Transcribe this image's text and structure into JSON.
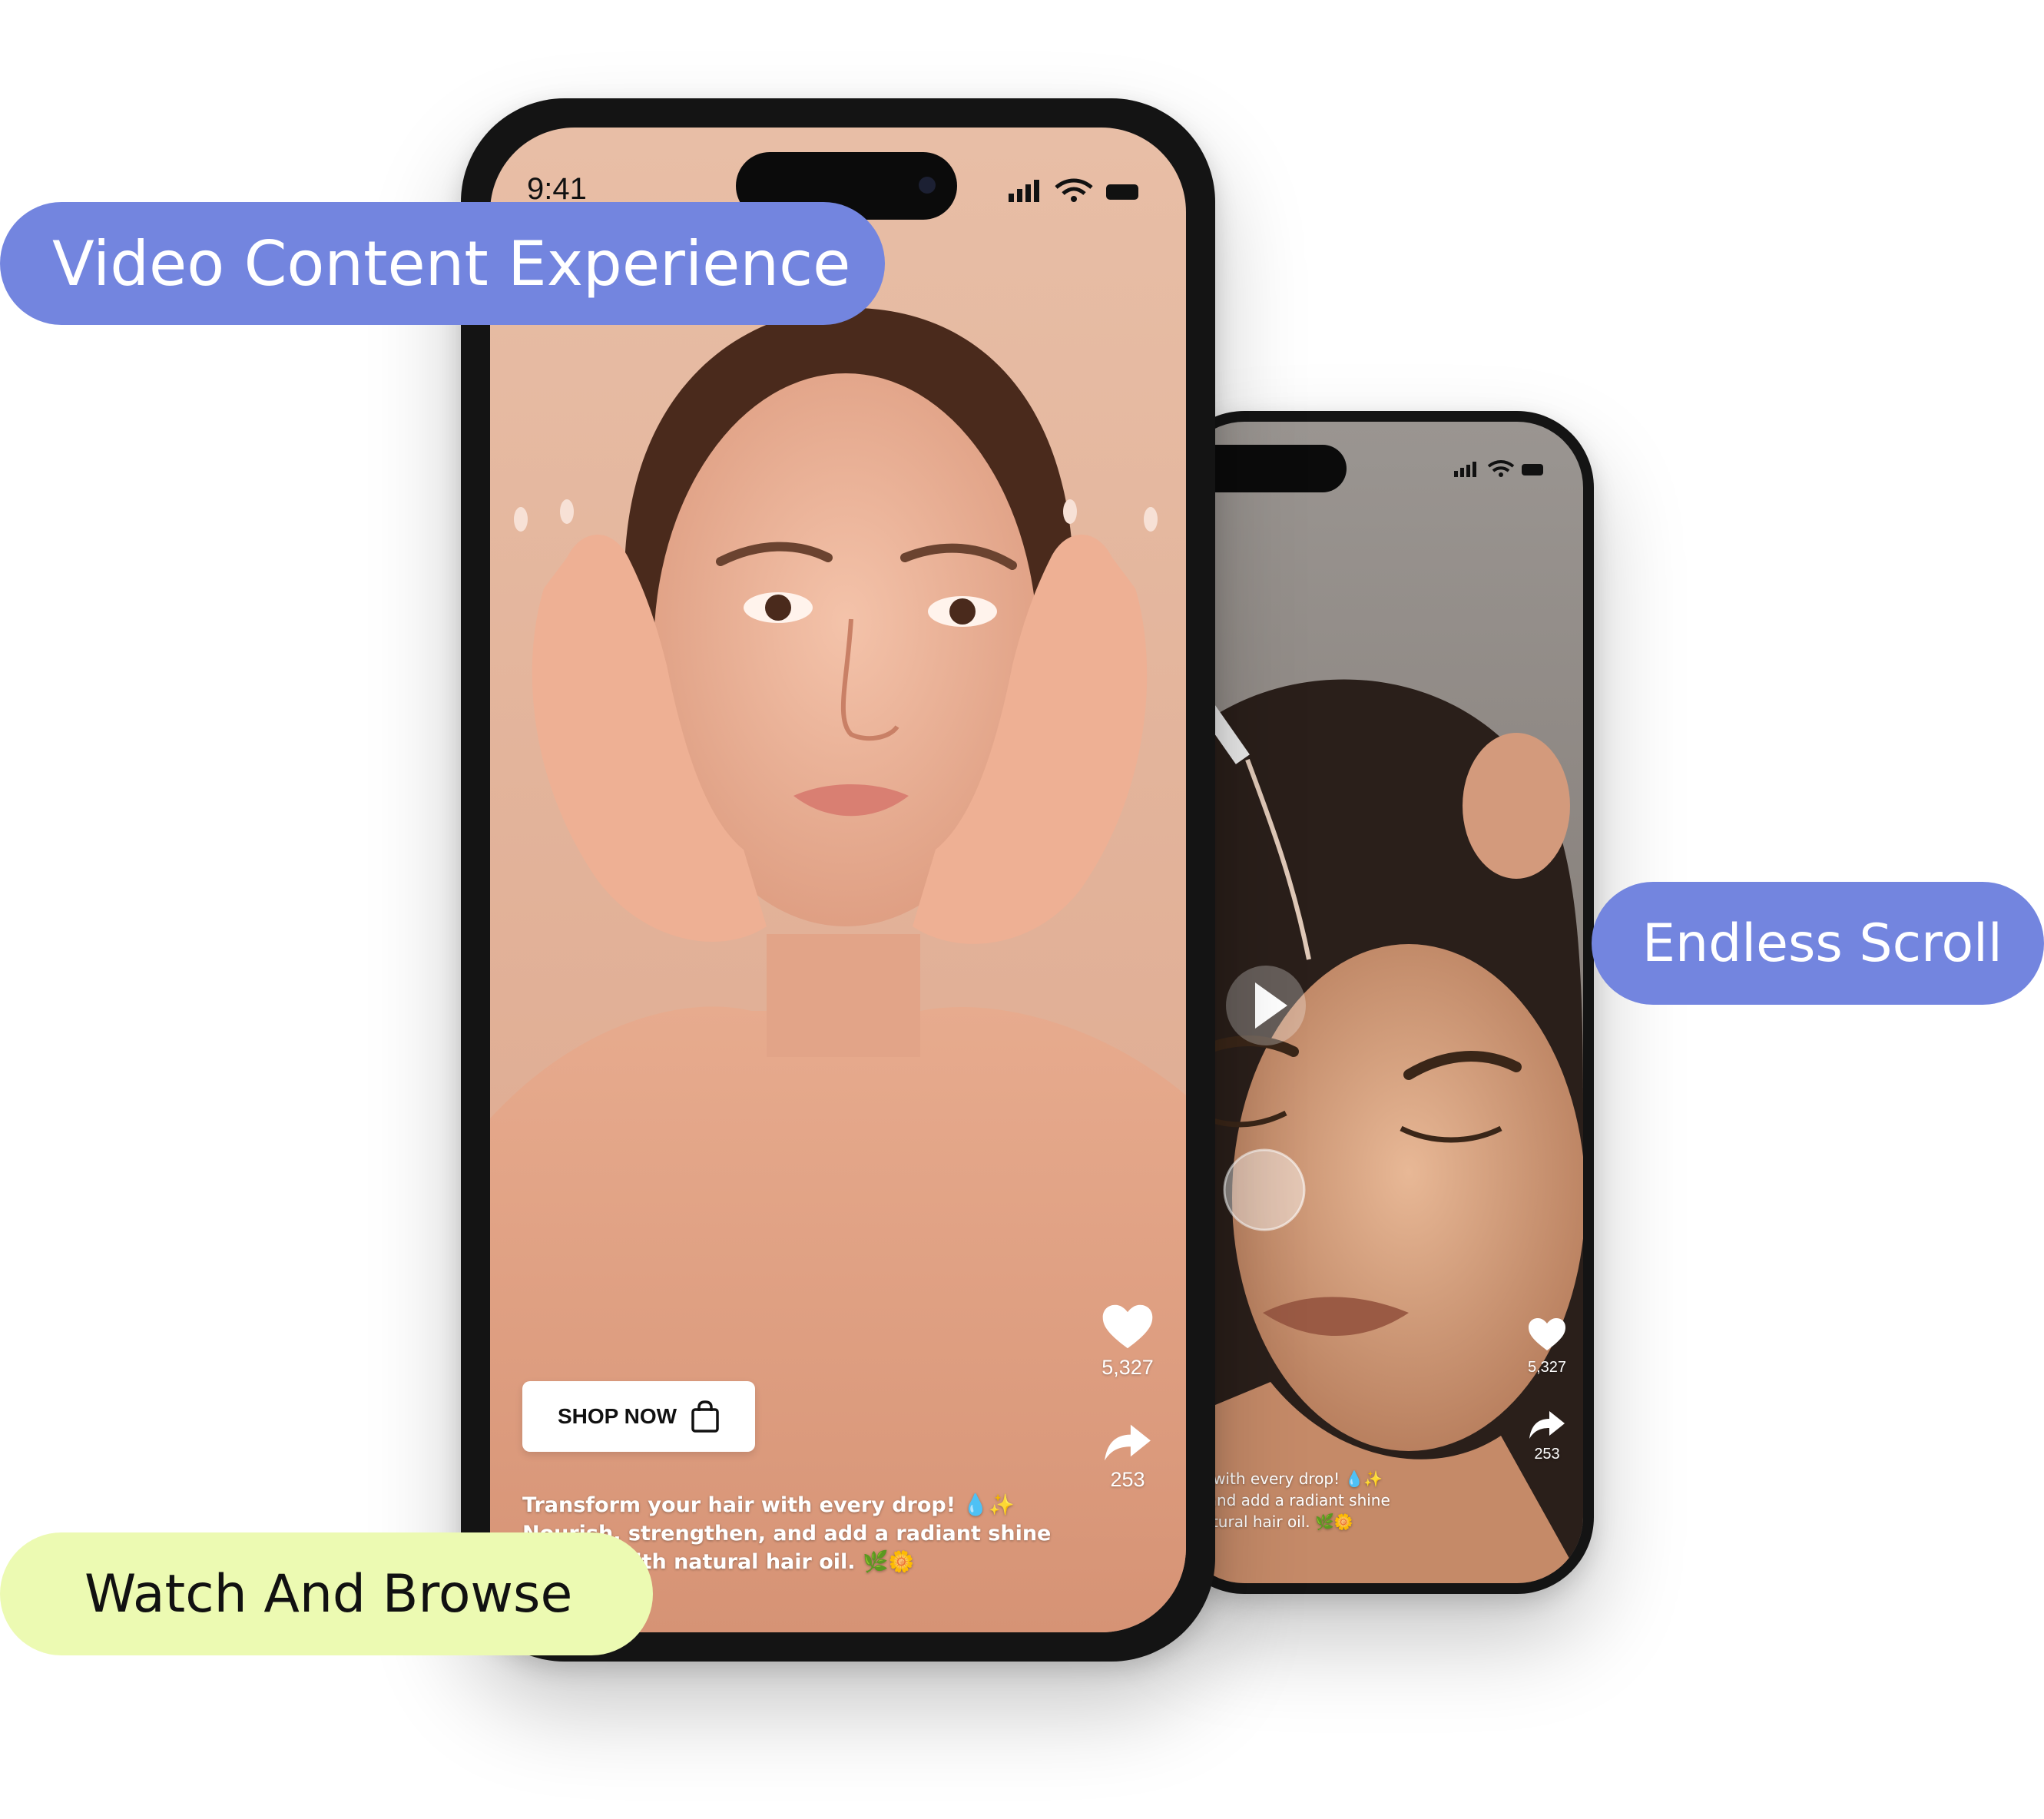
{
  "labels": {
    "video_content": "Video Content Experience",
    "endless_scroll": "Endless Scroll",
    "watch_browse": "Watch And Browse"
  },
  "phone_main": {
    "status_time": "9:41",
    "shop_button": "SHOP NOW",
    "likes": "5,327",
    "shares": "253",
    "caption_lines": [
      "Transform your hair with every drop! 💧✨",
      "Nourish, strengthen, and add a radiant shine",
      "it looks with natural hair oil. 🌿🌼"
    ]
  },
  "phone_secondary": {
    "likes": "5,327",
    "shares": "253",
    "caption_lines": [
      "hair with every drop! 💧✨",
      "en, and add a radiant shine",
      "h natural hair oil. 🌿🌼"
    ]
  },
  "colors": {
    "pill_blue": "#7385df",
    "pill_lime": "#ecfab2",
    "frame": "#141414",
    "bg_main": "#e6b8a0",
    "bg_secondary": "#8c8580"
  }
}
